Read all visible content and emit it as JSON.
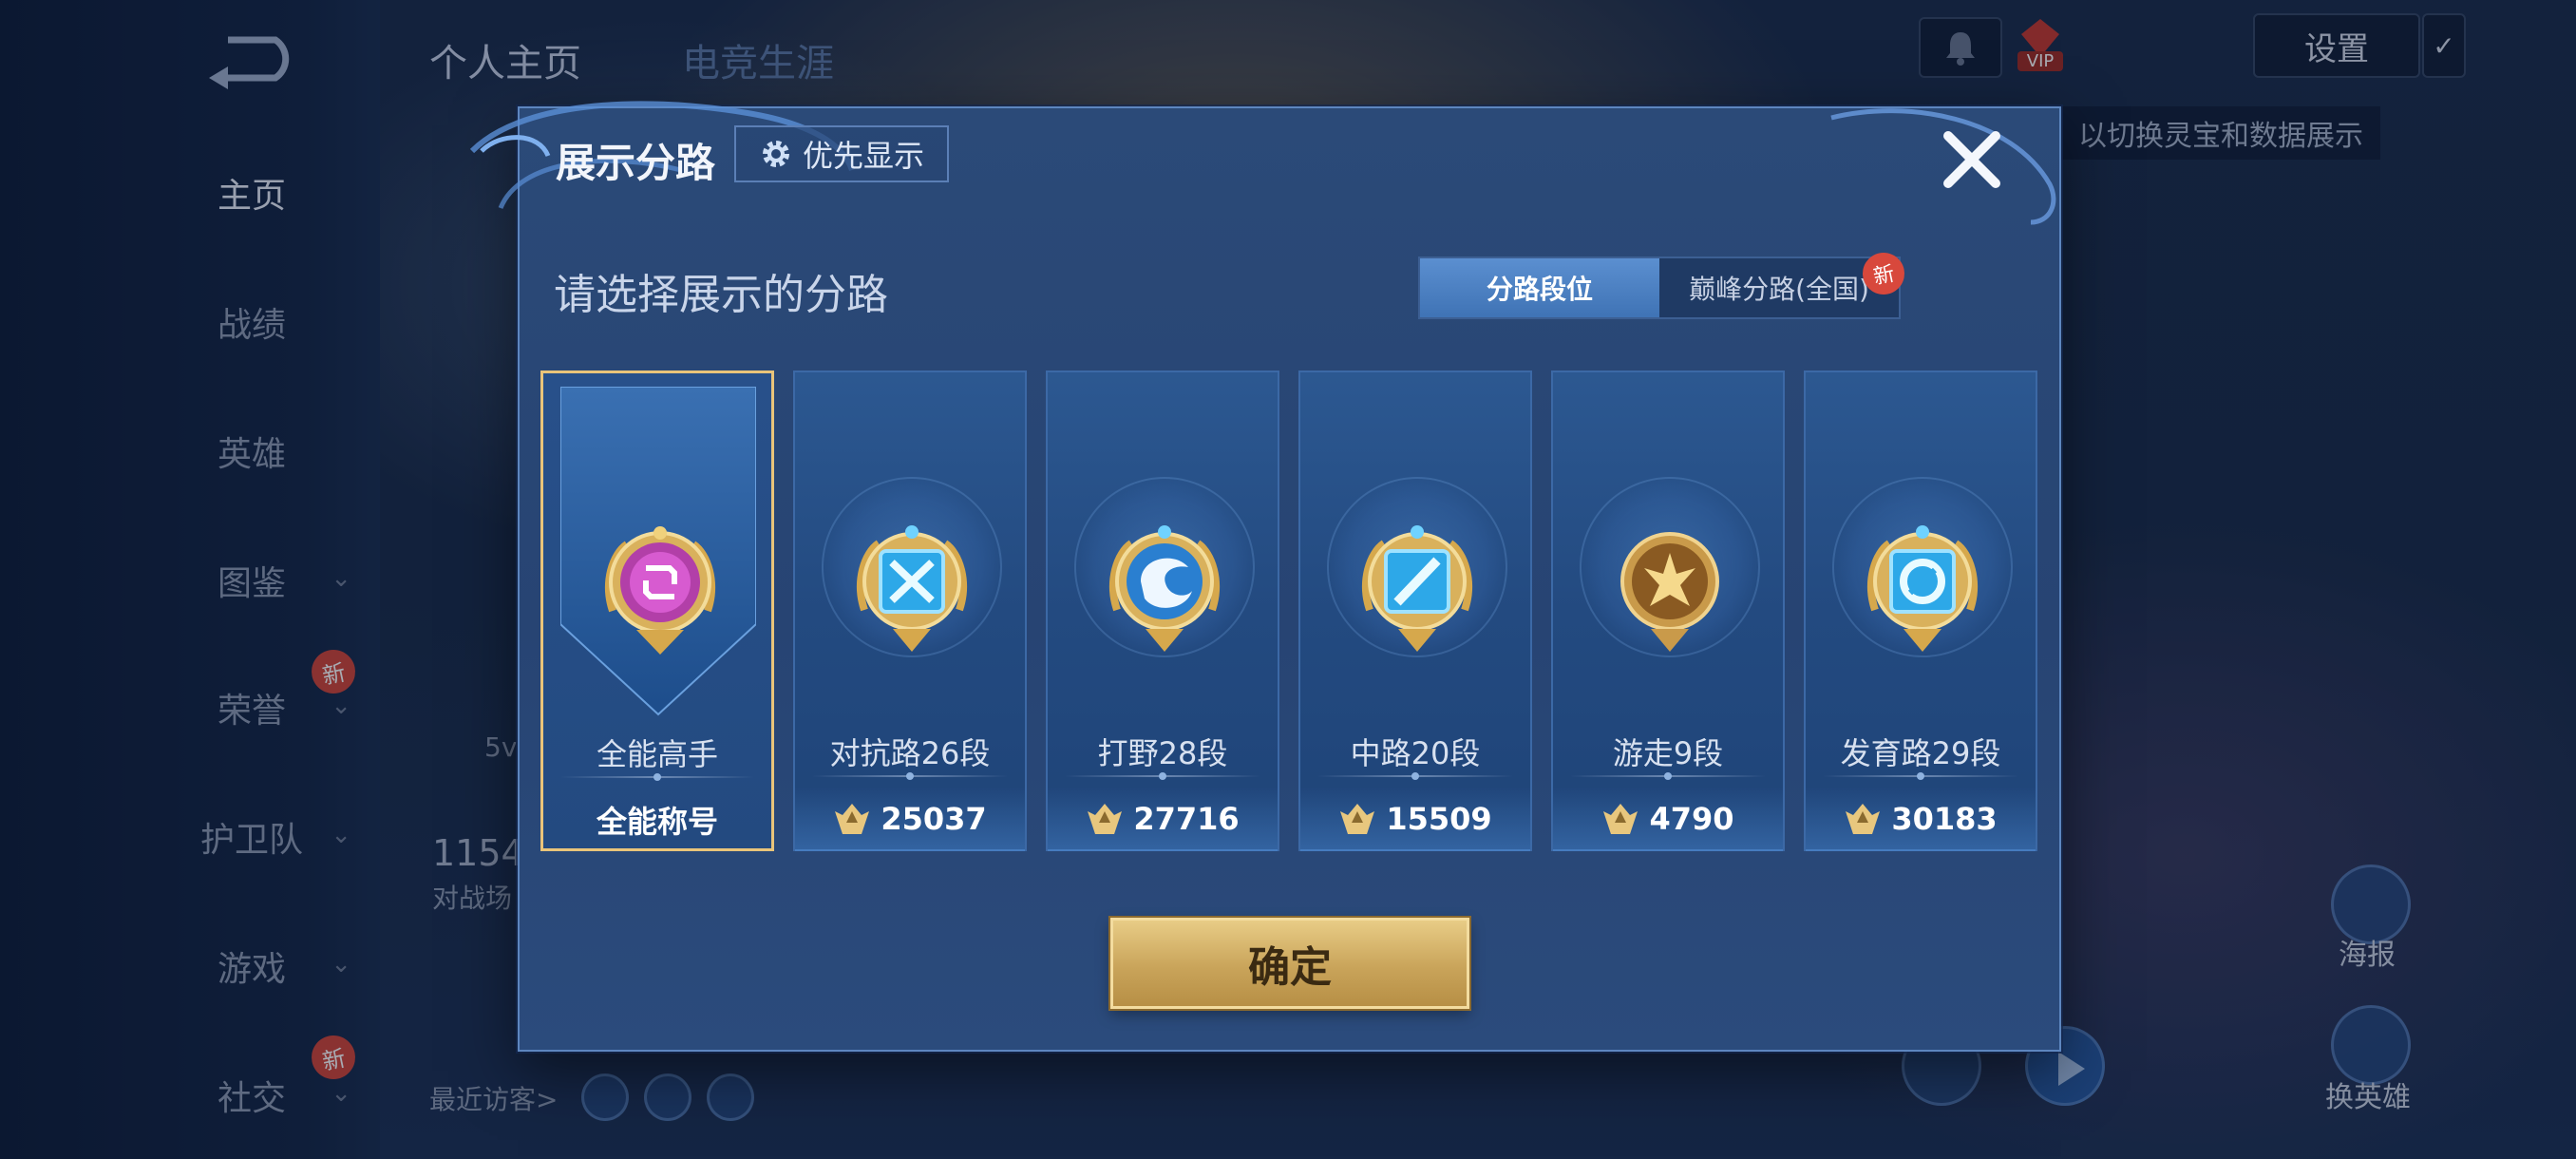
{
  "sidebar": {
    "items": [
      {
        "label": "主页",
        "active": true
      },
      {
        "label": "战绩"
      },
      {
        "label": "英雄"
      },
      {
        "label": "图鉴"
      },
      {
        "label": "荣誉",
        "badge": "新"
      },
      {
        "label": "护卫队"
      },
      {
        "label": "游戏"
      },
      {
        "label": "社交",
        "badge": "新"
      }
    ]
  },
  "header": {
    "tabs": [
      "个人主页",
      "电竞生涯"
    ],
    "settings_label": "设置",
    "vip_label": "VIP",
    "hint_text": "以切换灵宝和数据展示"
  },
  "background": {
    "visitors_label": "最近访客>",
    "stat_number": "1154",
    "stat_caption": "对战场",
    "side_label": "5v",
    "poster_label": "海报",
    "change_hero_label": "换英雄"
  },
  "modal": {
    "title": "展示分路",
    "priority_label": "优先显示",
    "subtitle": "请选择展示的分路",
    "tabs": [
      {
        "label": "分路段位",
        "active": true
      },
      {
        "label": "巅峰分路(全国)",
        "badge": "新"
      }
    ],
    "cards": [
      {
        "name": "全能高手",
        "stat": "全能称号",
        "icon": "allround-emblem-icon",
        "selected": true
      },
      {
        "name": "对抗路26段",
        "stat": "25037",
        "icon": "clash-lane-emblem-icon"
      },
      {
        "name": "打野28段",
        "stat": "27716",
        "icon": "jungle-emblem-icon"
      },
      {
        "name": "中路20段",
        "stat": "15509",
        "icon": "mid-lane-emblem-icon"
      },
      {
        "name": "游走9段",
        "stat": "4790",
        "icon": "roam-emblem-icon"
      },
      {
        "name": "发育路29段",
        "stat": "30183",
        "icon": "farm-lane-emblem-icon"
      }
    ],
    "confirm_label": "确定"
  },
  "colors": {
    "gold": "#e9c47a",
    "panel": "#2b4a78",
    "accent_blue": "#4a86cf",
    "badge_red": "#d8483c"
  }
}
